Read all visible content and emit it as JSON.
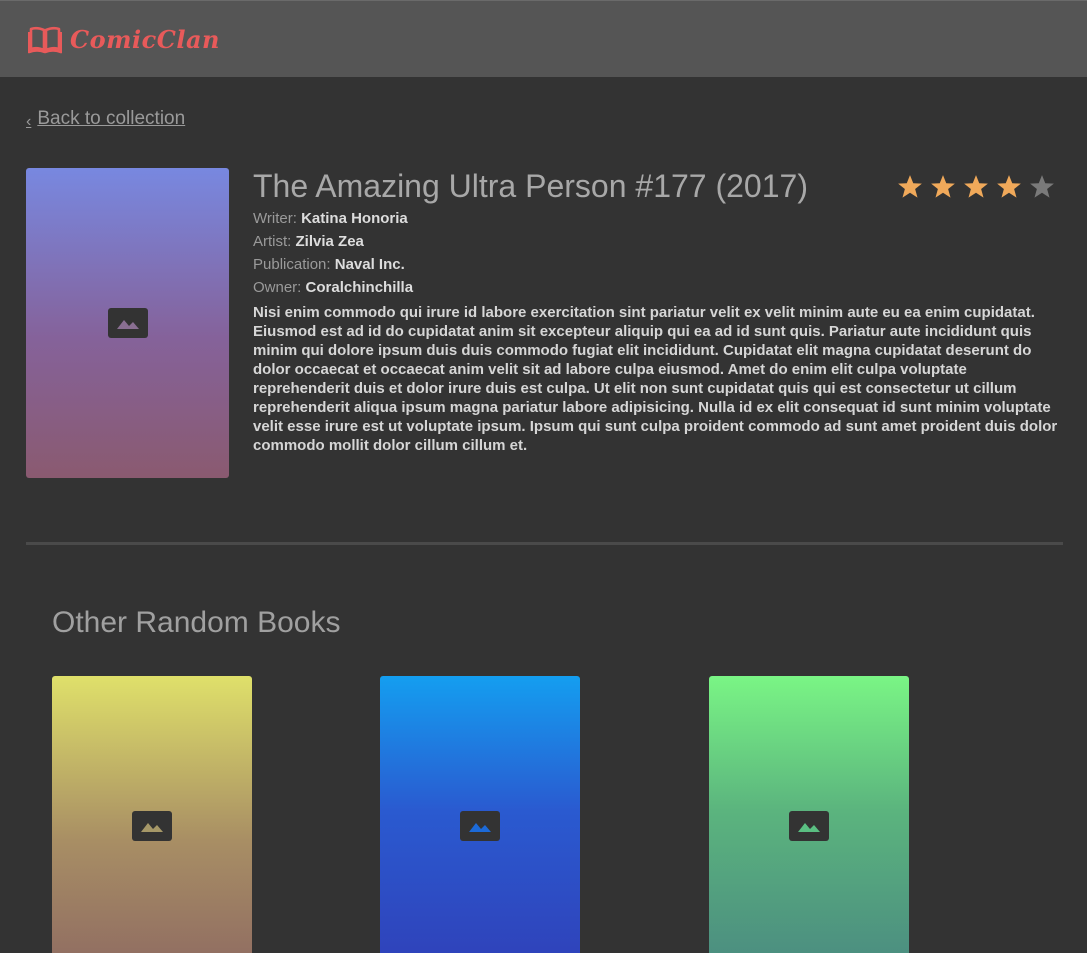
{
  "header": {
    "logo_text": "ComicClan",
    "logo_icon": "open-book-icon",
    "brand_color": "#e85a5a"
  },
  "nav": {
    "back_label": "Back to collection",
    "back_icon": "chevron-left-icon"
  },
  "comic": {
    "title": "The Amazing Ultra Person #177 (2017)",
    "rating": 4,
    "rating_max": 5,
    "star_color_on": "#f0a95a",
    "star_color_off": "#7a7a7a",
    "writer_label": "Writer:",
    "writer": "Katina Honoria",
    "artist_label": "Artist:",
    "artist": "Zilvia Zea",
    "publication_label": "Publication:",
    "publication": "Naval Inc.",
    "owner_label": "Owner:",
    "owner": "Coralchinchilla",
    "description": "Nisi enim commodo qui irure id labore exercitation sint pariatur velit ex velit minim aute eu ea enim cupidatat. Eiusmod est ad id do cupidatat anim sit excepteur aliquip qui ea ad id sunt quis. Pariatur aute incididunt quis minim qui dolore ipsum duis duis commodo fugiat elit incididunt. Cupidatat elit magna cupidatat deserunt do dolor occaecat et occaecat anim velit sit ad labore culpa eiusmod. Amet do enim elit culpa voluptate reprehenderit duis et dolor irure duis est culpa. Ut elit non sunt cupidatat quis qui est consectetur ut cillum reprehenderit aliqua ipsum magna pariatur labore adipisicing. Nulla id ex elit consequat id sunt minim voluptate velit esse irure est ut voluptate ipsum. Ipsum qui sunt culpa proident commodo ad sunt amet proident duis dolor commodo mollit dolor cillum cillum et.",
    "cover_icon": "image-placeholder-icon"
  },
  "other": {
    "heading": "Other Random Books",
    "books": [
      {
        "icon": "image-placeholder-icon",
        "icon_color": "#a69868"
      },
      {
        "icon": "image-placeholder-icon",
        "icon_color": "#1c6ad8"
      },
      {
        "icon": "image-placeholder-icon",
        "icon_color": "#5abf82"
      }
    ]
  }
}
